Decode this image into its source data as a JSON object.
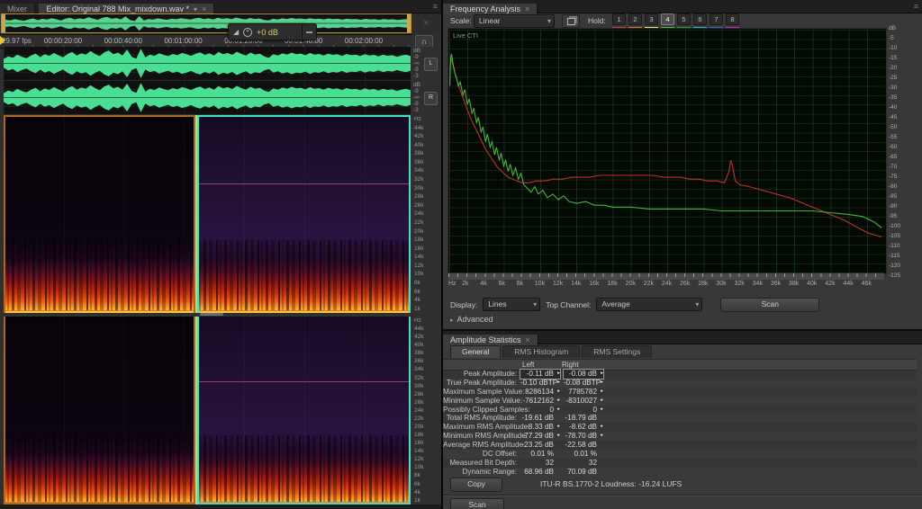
{
  "icons": {
    "chevron_down": "▾",
    "close": "×",
    "panel_menu": "≡",
    "loop": "∩",
    "ramp": "◢",
    "marker": "▸",
    "advanced_tri": "▸",
    "dim_tool": "×"
  },
  "editor": {
    "tabs": [
      "Mixer",
      "Editor: Original 788 Mix_mixdown.wav *"
    ],
    "hud": {
      "gain": "+0 dB"
    },
    "timeline": {
      "fps": "29.97 fps",
      "ticks": [
        "00:00:20:00",
        "00:00:40:00",
        "00:01:00:00",
        "00:01:20:00",
        "00:01:40:00",
        "00:02:00:00"
      ]
    },
    "wave_db_scale": [
      "dB",
      "-9",
      "-∞",
      "-9",
      "-3"
    ],
    "channels": [
      "L",
      "R"
    ],
    "spectro_scale": [
      "Hz",
      "44k",
      "42k",
      "40k",
      "38k",
      "36k",
      "34k",
      "32k",
      "30k",
      "28k",
      "26k",
      "24k",
      "22k",
      "20k",
      "18k",
      "16k",
      "14k",
      "12k",
      "10k",
      "8k",
      "6k",
      "4k",
      "1k"
    ],
    "envelope": [
      0.28,
      0.45,
      0.36,
      0.55,
      0.42,
      0.33,
      0.5,
      0.62,
      0.4,
      0.58,
      0.48,
      0.66,
      0.52,
      0.38,
      0.6,
      0.72,
      0.5,
      0.64,
      0.56,
      0.78,
      0.6,
      0.46,
      0.7,
      0.82,
      0.58,
      0.68,
      0.5,
      0.88,
      0.42,
      0.3,
      0.92,
      0.38,
      0.56,
      0.48,
      0.64,
      0.54,
      0.46,
      0.6,
      0.52,
      0.66,
      0.58,
      0.48,
      0.62,
      0.7,
      0.54,
      0.64,
      0.5,
      0.72,
      0.58,
      0.66,
      0.54,
      0.74,
      0.6,
      0.5,
      0.68,
      0.56,
      0.62,
      0.44,
      0.36,
      0.58,
      0.5,
      0.64,
      0.56,
      0.68,
      0.58,
      0.62,
      0.52,
      0.66,
      0.56,
      0.6,
      0.5,
      0.62,
      0.54,
      0.58,
      0.48,
      0.6,
      0.52,
      0.56,
      0.46,
      0.58,
      0.5,
      0.54,
      0.44,
      0.56,
      0.48,
      0.52,
      0.42,
      0.5,
      0.55,
      0.46
    ]
  },
  "frequency_analysis": {
    "tab": "Frequency Analysis",
    "scale_label": "Scale:",
    "scale_value": "Linear",
    "hold_label": "Hold:",
    "holds": [
      {
        "label": "1",
        "color": "#c93a30"
      },
      {
        "label": "2",
        "color": "#cc7a29"
      },
      {
        "label": "3",
        "color": "#e6e68a"
      },
      {
        "label": "4",
        "color": "#33cc33",
        "active": true
      },
      {
        "label": "5",
        "color": "#2e9e2e"
      },
      {
        "label": "6",
        "color": "#2eb8c8"
      },
      {
        "label": "7",
        "color": "#2e66cc"
      },
      {
        "label": "8",
        "color": "#bb33bb"
      }
    ],
    "graph_label": "Live CTI",
    "display_label": "Display:",
    "display_value": "Lines",
    "top_channel_label": "Top Channel:",
    "top_channel_value": "Average",
    "scan_label": "Scan",
    "advanced_label": "Advanced"
  },
  "chart_data": {
    "type": "line",
    "title": "Frequency Analysis",
    "xlabel": "Hz",
    "ylabel": "dB",
    "xlim": [
      0,
      48000
    ],
    "ylim": [
      -130,
      0
    ],
    "x_tick_labels": [
      "Hz",
      "2k",
      "4k",
      "6k",
      "8k",
      "10k",
      "12k",
      "14k",
      "16k",
      "18k",
      "20k",
      "22k",
      "24k",
      "26k",
      "28k",
      "30k",
      "32k",
      "34k",
      "36k",
      "38k",
      "40k",
      "42k",
      "44k",
      "46k"
    ],
    "y_tick_labels": [
      "dB",
      "-5",
      "-10",
      "-15",
      "-20",
      "-25",
      "-30",
      "-35",
      "-40",
      "-45",
      "-50",
      "-55",
      "-60",
      "-65",
      "-70",
      "-75",
      "-80",
      "-85",
      "-90",
      "-95",
      "-100",
      "-105",
      "-110",
      "-115",
      "-120",
      "-125"
    ],
    "grid": true,
    "legend": "none",
    "series": [
      {
        "name": "Top channel (green)",
        "color": "#44b33c",
        "points": [
          [
            50,
            -30
          ],
          [
            150,
            -15
          ],
          [
            250,
            -13
          ],
          [
            400,
            -18
          ],
          [
            600,
            -23
          ],
          [
            800,
            -26
          ],
          [
            1000,
            -30
          ],
          [
            1200,
            -28
          ],
          [
            1500,
            -35
          ],
          [
            1700,
            -32
          ],
          [
            2000,
            -40
          ],
          [
            2200,
            -37
          ],
          [
            2500,
            -45
          ],
          [
            2700,
            -42
          ],
          [
            3000,
            -50
          ],
          [
            3200,
            -47
          ],
          [
            3500,
            -55
          ],
          [
            3700,
            -52
          ],
          [
            4000,
            -60
          ],
          [
            4200,
            -56
          ],
          [
            4500,
            -63
          ],
          [
            4700,
            -60
          ],
          [
            5000,
            -67
          ],
          [
            5200,
            -63
          ],
          [
            5500,
            -70
          ],
          [
            5700,
            -66
          ],
          [
            6000,
            -73
          ],
          [
            6200,
            -70
          ],
          [
            6500,
            -76
          ],
          [
            6700,
            -72
          ],
          [
            7000,
            -78
          ],
          [
            7300,
            -74
          ],
          [
            7600,
            -80
          ],
          [
            7900,
            -77
          ],
          [
            8200,
            -83
          ],
          [
            8600,
            -85
          ],
          [
            9000,
            -87
          ],
          [
            9400,
            -84
          ],
          [
            9800,
            -88
          ],
          [
            10300,
            -86
          ],
          [
            10800,
            -90
          ],
          [
            11400,
            -88
          ],
          [
            12000,
            -91
          ],
          [
            12600,
            -89
          ],
          [
            13200,
            -92
          ],
          [
            14000,
            -93
          ],
          [
            15000,
            -92
          ],
          [
            16000,
            -94
          ],
          [
            17000,
            -94
          ],
          [
            18000,
            -95
          ],
          [
            19000,
            -95
          ],
          [
            20000,
            -95
          ],
          [
            22000,
            -96
          ],
          [
            24000,
            -96
          ],
          [
            26000,
            -96
          ],
          [
            28000,
            -96
          ],
          [
            30000,
            -97
          ],
          [
            32000,
            -97
          ],
          [
            34000,
            -97
          ],
          [
            36000,
            -97
          ],
          [
            38000,
            -97
          ],
          [
            40000,
            -97
          ],
          [
            42000,
            -98
          ],
          [
            44000,
            -99
          ],
          [
            45500,
            -100
          ],
          [
            46800,
            -103
          ],
          [
            47600,
            -106
          ]
        ]
      },
      {
        "name": "Bottom channel (red)",
        "color": "#c23028",
        "points": [
          [
            50,
            -22
          ],
          [
            120,
            -18
          ],
          [
            200,
            -15
          ],
          [
            350,
            -18
          ],
          [
            500,
            -21
          ],
          [
            700,
            -25
          ],
          [
            900,
            -28
          ],
          [
            1100,
            -31
          ],
          [
            1400,
            -35
          ],
          [
            1700,
            -39
          ],
          [
            2000,
            -43
          ],
          [
            2400,
            -48
          ],
          [
            2800,
            -52
          ],
          [
            3200,
            -56
          ],
          [
            3600,
            -60
          ],
          [
            4000,
            -64
          ],
          [
            4400,
            -67
          ],
          [
            4800,
            -70
          ],
          [
            5200,
            -73
          ],
          [
            5600,
            -75
          ],
          [
            6000,
            -77
          ],
          [
            6500,
            -79
          ],
          [
            7000,
            -80
          ],
          [
            7500,
            -81
          ],
          [
            8000,
            -82
          ],
          [
            8800,
            -82
          ],
          [
            9600,
            -81
          ],
          [
            10500,
            -81
          ],
          [
            11500,
            -80
          ],
          [
            12500,
            -80
          ],
          [
            13500,
            -79
          ],
          [
            14500,
            -79
          ],
          [
            15500,
            -79
          ],
          [
            16500,
            -78
          ],
          [
            17500,
            -78
          ],
          [
            18500,
            -78
          ],
          [
            19500,
            -78
          ],
          [
            20500,
            -78
          ],
          [
            21500,
            -78
          ],
          [
            22500,
            -78
          ],
          [
            23500,
            -79
          ],
          [
            24500,
            -79
          ],
          [
            25500,
            -79
          ],
          [
            26500,
            -80
          ],
          [
            27500,
            -80
          ],
          [
            28500,
            -81
          ],
          [
            29500,
            -81
          ],
          [
            30300,
            -82
          ],
          [
            30800,
            -76
          ],
          [
            31000,
            -70
          ],
          [
            31200,
            -73
          ],
          [
            31500,
            -81
          ],
          [
            32000,
            -83
          ],
          [
            33000,
            -84
          ],
          [
            34500,
            -86
          ],
          [
            36000,
            -88
          ],
          [
            37500,
            -90
          ],
          [
            39000,
            -93
          ],
          [
            40500,
            -96
          ],
          [
            42000,
            -99
          ],
          [
            43500,
            -102
          ],
          [
            45000,
            -106
          ],
          [
            46200,
            -109
          ],
          [
            47600,
            -111
          ]
        ]
      }
    ]
  },
  "amplitude_statistics": {
    "tab": "Amplitude Statistics",
    "sub_tabs": [
      "General",
      "RMS Histogram",
      "RMS Settings"
    ],
    "columns": [
      "Left",
      "Right"
    ],
    "rows": [
      {
        "label": "Peak Amplitude:",
        "left": "-0.11 dB",
        "right": "-0.08 dB",
        "marker": true,
        "boxed": true
      },
      {
        "label": "True Peak Amplitude:",
        "left": "-0.10 dBTP",
        "right": "-0.08 dBTP",
        "marker": true
      },
      {
        "label": "Maximum Sample Value:",
        "left": "8286134",
        "right": "7785782",
        "marker": true
      },
      {
        "label": "Minimum Sample Value:",
        "left": "-7612162",
        "right": "-8310027",
        "marker": true
      },
      {
        "label": "Possibly Clipped Samples:",
        "left": "0",
        "right": "0",
        "marker": true
      },
      {
        "label": "Total RMS Amplitude:",
        "left": "-19.61 dB",
        "right": "-18.79 dB",
        "marker": false
      },
      {
        "label": "Maximum RMS Amplitude:",
        "left": "-8.33 dB",
        "right": "-8.62 dB",
        "marker": true
      },
      {
        "label": "Minimum RMS Amplitude:",
        "left": "-77.29 dB",
        "right": "-78.70 dB",
        "marker": true
      },
      {
        "label": "Average RMS Amplitude:",
        "left": "-23.25 dB",
        "right": "-22.58 dB",
        "marker": false
      },
      {
        "label": "DC Offset:",
        "left": "0.01 %",
        "right": "0.01 %",
        "marker": false
      },
      {
        "label": "Measured Bit Depth:",
        "left": "32",
        "right": "32",
        "marker": false
      },
      {
        "label": "Dynamic Range:",
        "left": "68.96 dB",
        "right": "70.09 dB",
        "marker": false
      }
    ],
    "copy_label": "Copy",
    "loudness": "ITU-R BS.1770-2 Loudness:  -16.24 LUFS",
    "scan_label": "Scan"
  }
}
